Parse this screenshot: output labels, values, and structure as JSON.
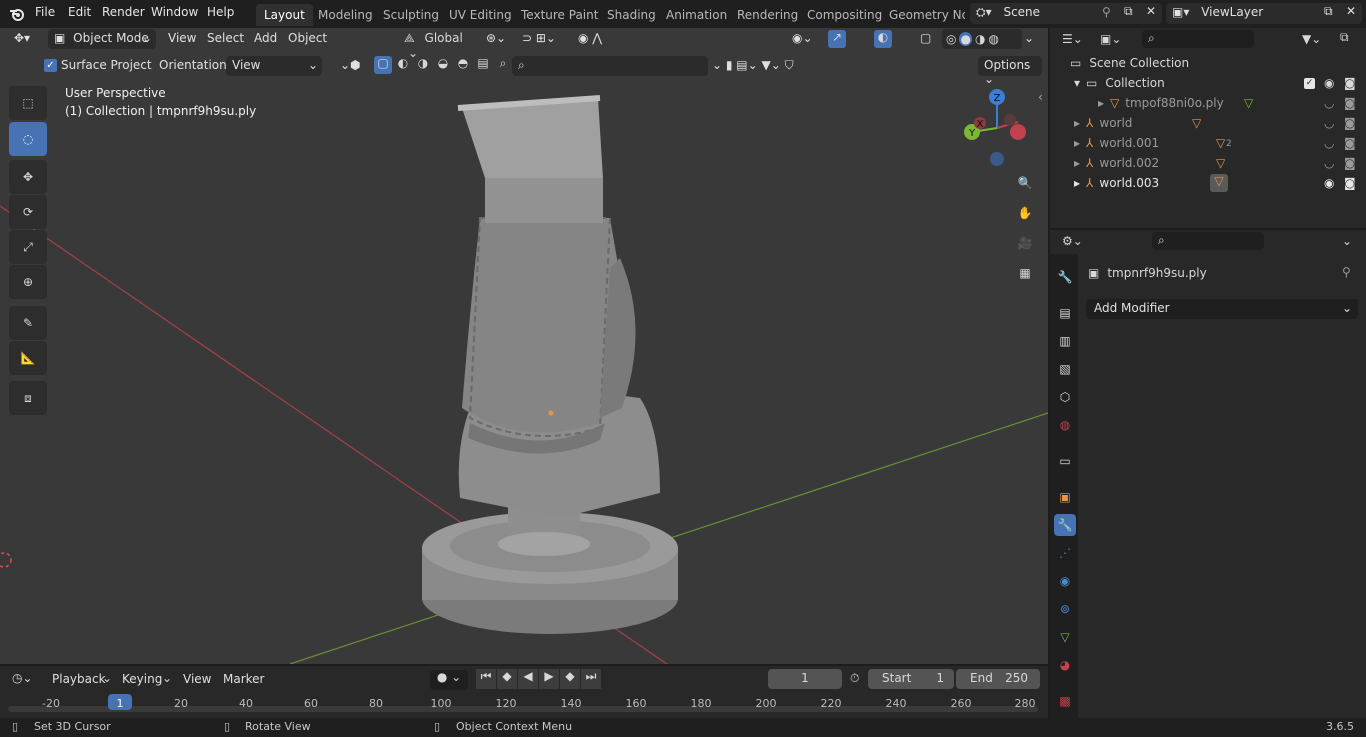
{
  "menu": {
    "items": [
      "File",
      "Edit",
      "Render",
      "Window",
      "Help"
    ],
    "workspaces": [
      "Layout",
      "Modeling",
      "Sculpting",
      "UV Editing",
      "Texture Paint",
      "Shading",
      "Animation",
      "Rendering",
      "Compositing",
      "Geometry Noc"
    ],
    "active_workspace": "Layout",
    "scene": "Scene",
    "view_layer": "ViewLayer"
  },
  "viewport": {
    "mode": "Object Mode",
    "menus": [
      "View",
      "Select",
      "Add",
      "Object"
    ],
    "transform_orientation": "Global",
    "surface_project_label": "Surface Project",
    "surface_project_checked": true,
    "orientation_label": "Orientation:",
    "orientation_value": "View",
    "options_label": "Options",
    "overlay_title": "User Perspective",
    "overlay_subtitle": "(1) Collection | tmpnrf9h9su.ply",
    "gizmo_axes": {
      "x": "X",
      "y": "Y",
      "z": "Z"
    }
  },
  "outliner": {
    "root": "Scene Collection",
    "collection": "Collection",
    "items": [
      {
        "name": "tmpof88ni0o.ply",
        "badge": ""
      },
      {
        "name": "world",
        "badge": ""
      },
      {
        "name": "world.001",
        "badge": "2"
      },
      {
        "name": "world.002",
        "badge": ""
      },
      {
        "name": "world.003",
        "badge": ""
      }
    ]
  },
  "properties": {
    "object_name": "tmpnrf9h9su.ply",
    "add_modifier": "Add Modifier"
  },
  "timeline": {
    "menus": [
      "Playback",
      "Keying",
      "View",
      "Marker"
    ],
    "current_frame": "1",
    "start_label": "Start",
    "start_value": "1",
    "end_label": "End",
    "end_value": "250",
    "ticks": [
      "-20",
      "1",
      "20",
      "40",
      "60",
      "80",
      "100",
      "120",
      "140",
      "160",
      "180",
      "200",
      "220",
      "240",
      "260",
      "280"
    ]
  },
  "status": {
    "left": "Set 3D Cursor",
    "middle": "Rotate View",
    "right": "Object Context Menu",
    "version": "3.6.5"
  },
  "colors": {
    "accent": "#4772b3",
    "x_axis": "#c3414d",
    "y_axis": "#7ab934",
    "z_axis": "#3b7fd4",
    "object_orange": "#e89646"
  }
}
